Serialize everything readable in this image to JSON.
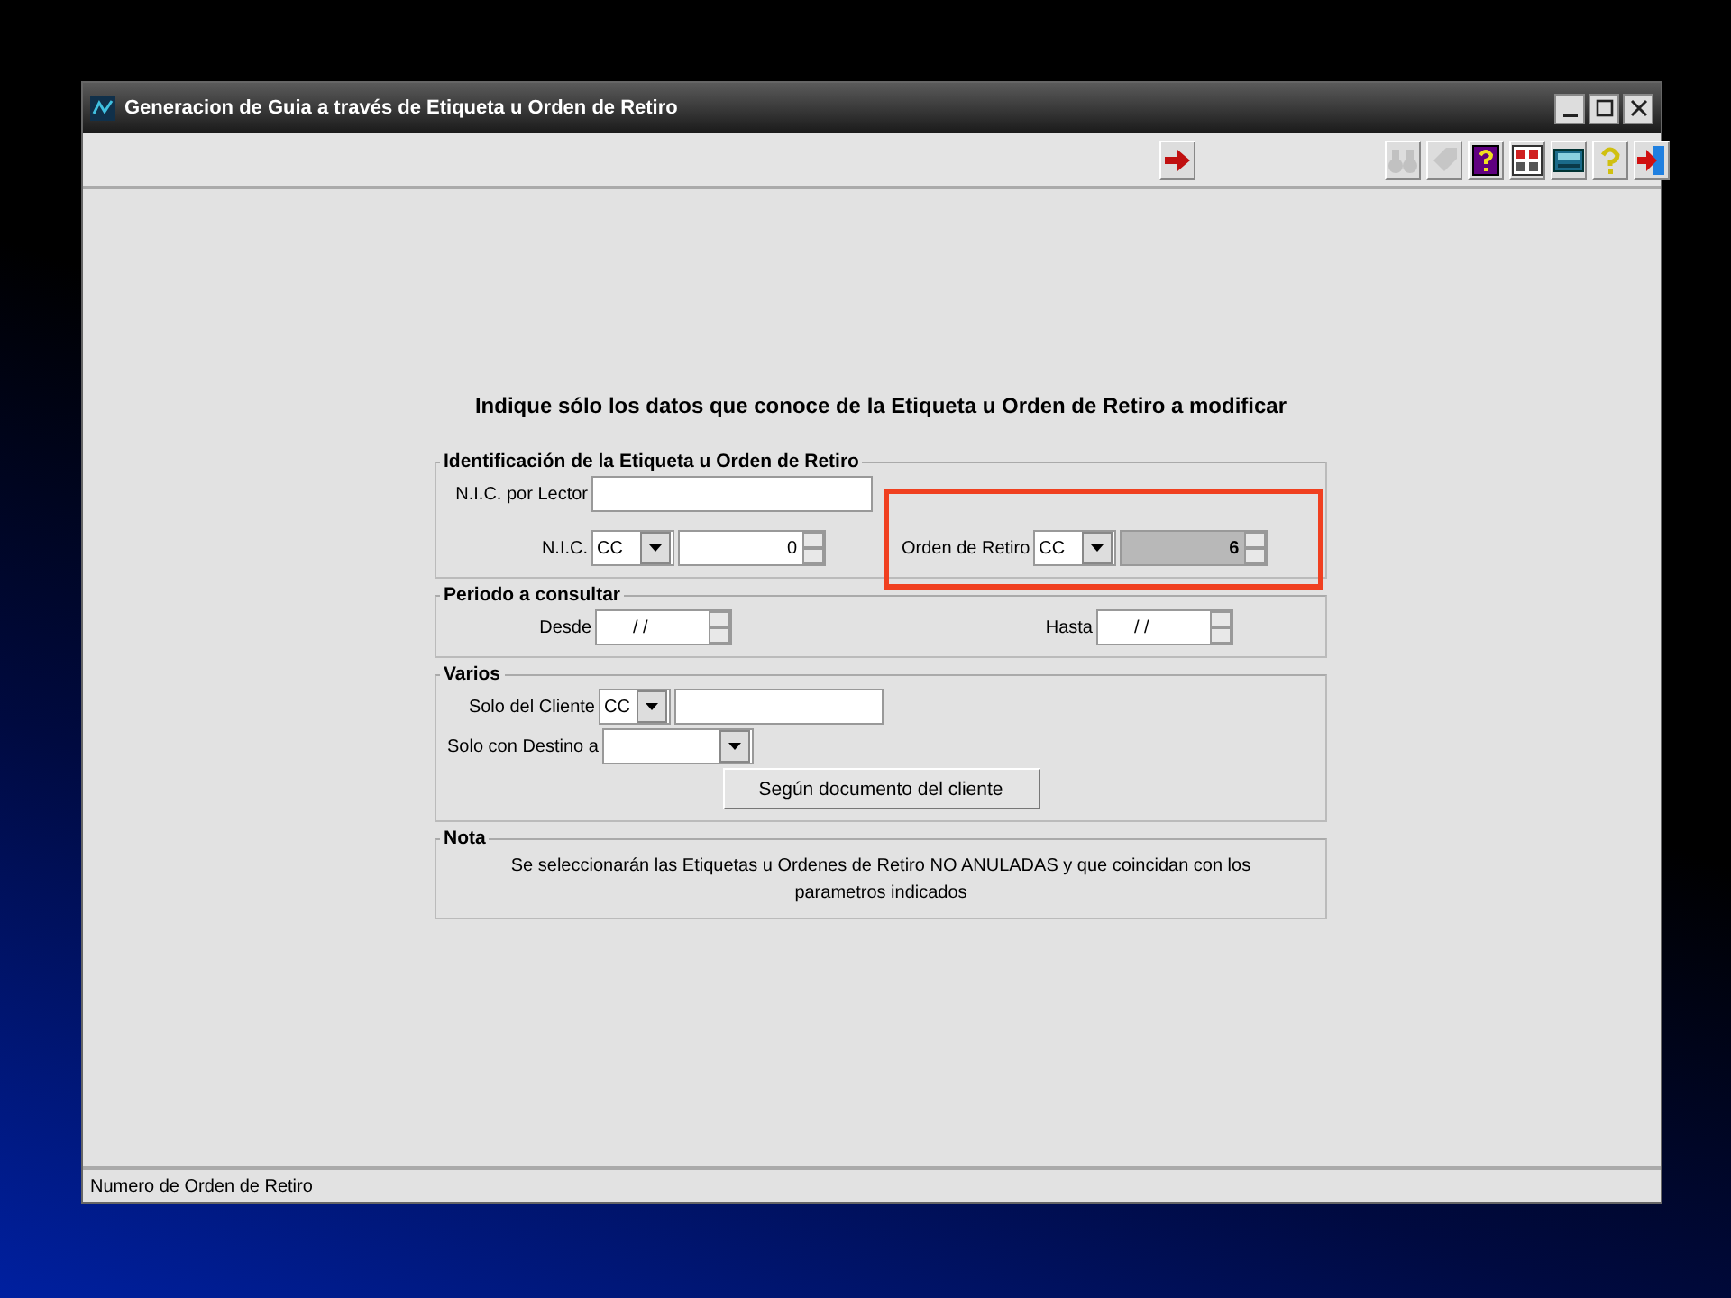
{
  "window": {
    "title": "Generacion de Guia a través de Etiqueta u Orden de Retiro"
  },
  "toolbar": {
    "buttons": [
      {
        "kind": "next",
        "disabled": false
      },
      {
        "kind": "find",
        "disabled": true
      },
      {
        "kind": "tag",
        "disabled": true
      },
      {
        "kind": "help-box",
        "disabled": false
      },
      {
        "kind": "grid",
        "disabled": false
      },
      {
        "kind": "calculator",
        "disabled": false
      },
      {
        "kind": "help",
        "disabled": false
      },
      {
        "kind": "exit",
        "disabled": false
      }
    ]
  },
  "heading": "Indique sólo los datos que conoce de la Etiqueta u Orden de Retiro a modificar",
  "identification": {
    "legend": "Identificación de la Etiqueta u Orden de Retiro",
    "nic_reader": {
      "label": "N.I.C. por Lector"
    },
    "nic": {
      "label": "N.I.C.",
      "type": "CC",
      "value": "0",
      "disabled": false
    },
    "withdrawal_order": {
      "label": "Orden de Retiro",
      "type": "CC",
      "value": "6",
      "disabled": true,
      "highlighted": true
    }
  },
  "period": {
    "legend": "Periodo a consultar",
    "from": {
      "label": "Desde",
      "value": "/ /"
    },
    "to": {
      "label": "Hasta",
      "value": "/ /"
    }
  },
  "various": {
    "legend": "Varios",
    "client": {
      "label": "Solo del Cliente",
      "type": "CC"
    },
    "destination": {
      "label": "Solo con Destino a"
    },
    "button": "Según documento del cliente"
  },
  "note": {
    "legend": "Nota",
    "text": "Se seleccionarán las Etiquetas u Ordenes de Retiro NO ANULADAS y que coincidan con los parametros indicados"
  },
  "status_bar": "Numero de Orden de Retiro"
}
